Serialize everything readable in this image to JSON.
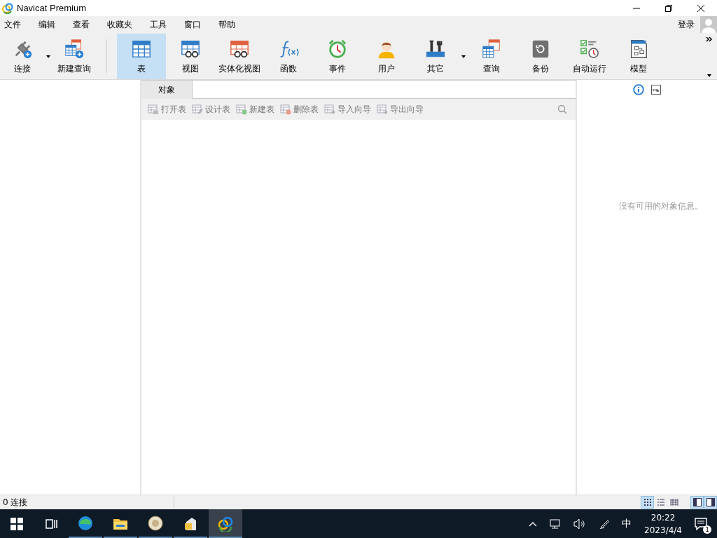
{
  "window": {
    "title": "Navicat Premium"
  },
  "menu": [
    "文件",
    "编辑",
    "查看",
    "收藏夹",
    "工具",
    "窗口",
    "帮助"
  ],
  "login": "登录",
  "toolbar": {
    "left": [
      {
        "label": "连接",
        "dropdown": true
      },
      {
        "label": "新建查询",
        "dropdown": false
      }
    ],
    "objects": [
      {
        "label": "表",
        "selected": true,
        "dropdown": false
      },
      {
        "label": "视图",
        "selected": false,
        "dropdown": false
      },
      {
        "label": "实体化视图",
        "selected": false,
        "dropdown": false
      },
      {
        "label": "函数",
        "selected": false,
        "dropdown": false
      },
      {
        "label": "事件",
        "selected": false,
        "dropdown": false
      },
      {
        "label": "用户",
        "selected": false,
        "dropdown": false
      },
      {
        "label": "其它",
        "selected": false,
        "dropdown": true
      },
      {
        "label": "查询",
        "selected": false,
        "dropdown": false
      },
      {
        "label": "备份",
        "selected": false,
        "dropdown": false
      },
      {
        "label": "自动运行",
        "selected": false,
        "dropdown": false
      },
      {
        "label": "模型",
        "selected": false,
        "dropdown": false
      }
    ]
  },
  "object_tab": {
    "label": "对象",
    "selected": true
  },
  "object_tools": [
    {
      "label": "打开表",
      "disabled": true
    },
    {
      "label": "设计表",
      "disabled": true
    },
    {
      "label": "新建表",
      "disabled": true
    },
    {
      "label": "删除表",
      "disabled": true
    },
    {
      "label": "导入向导",
      "disabled": true
    },
    {
      "label": "导出向导",
      "disabled": true
    }
  ],
  "info_panel": {
    "message": "没有可用的对象信息。"
  },
  "status_bar": {
    "connections": "0 连接",
    "view_modes": [
      {
        "selected": true
      },
      {
        "selected": false
      },
      {
        "selected": false
      }
    ],
    "panels": [
      {
        "on": true
      },
      {
        "on": true
      }
    ]
  },
  "taskbar": {
    "apps": [
      {
        "active": false
      },
      {
        "active": false
      },
      {
        "active": false
      },
      {
        "active": false
      },
      {
        "active": true
      }
    ],
    "ime": "中",
    "time": "20:22",
    "date": "2023/4/4",
    "notifications": "1"
  }
}
